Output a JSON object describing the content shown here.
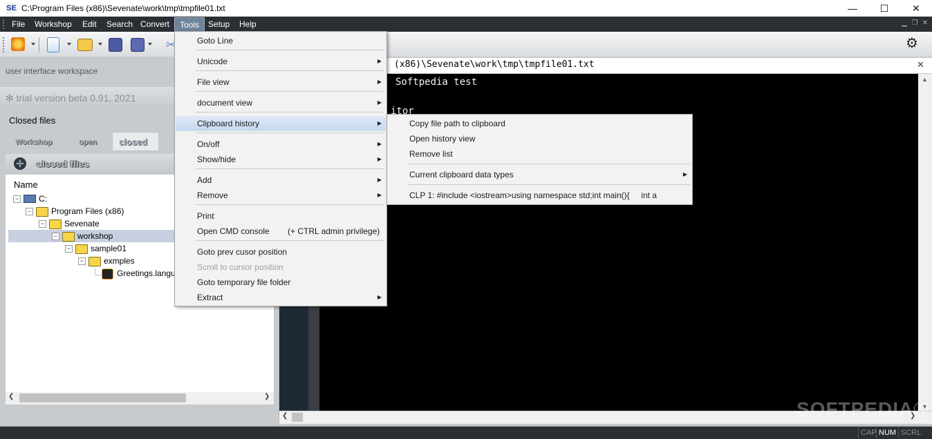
{
  "window": {
    "title": "C:\\Program Files (x86)\\Sevenate\\work\\tmp\\tmpfile01.txt",
    "logo_text": "SE",
    "minimize_glyph": "—",
    "maximize_glyph": "☐",
    "close_glyph": "✕"
  },
  "menubar": {
    "items": [
      "File",
      "Workshop",
      "Edit",
      "Search",
      "Convert",
      "Tools",
      "Setup",
      "Help"
    ],
    "active": "Tools"
  },
  "toolbar": {
    "icons": [
      "settings-tool-icon",
      "new-file-icon",
      "open-folder-icon",
      "save-icon",
      "save-all-icon",
      "cut-icon"
    ],
    "gear_glyph": "⚙"
  },
  "left_panel": {
    "workspace_label": "user interface workspace",
    "trial_text": "✻ trial version beta 0.91, 2021",
    "section_title": "Closed files",
    "tabs": [
      "Workshop",
      "open",
      "closed"
    ],
    "active_tab": "closed",
    "closed_header": "closed files",
    "tree_header": "Name",
    "tree": [
      {
        "label": "C:",
        "level": 0,
        "type": "drive"
      },
      {
        "label": "Program Files (x86)",
        "level": 1,
        "type": "folder"
      },
      {
        "label": "Sevenate",
        "level": 2,
        "type": "folder"
      },
      {
        "label": "workshop",
        "level": 3,
        "type": "folder",
        "selected": true
      },
      {
        "label": "sample01",
        "level": 4,
        "type": "folder"
      },
      {
        "label": "exmples",
        "level": 5,
        "type": "folder"
      },
      {
        "label": "Greetings.langu",
        "level": 6,
        "type": "file"
      }
    ]
  },
  "editor": {
    "tab_path": "(x86)\\Sevenate\\work\\tmp\\tmpfile01.txt",
    "close_glyph": "✕",
    "lines": [
      "Softpedia test",
      "itor"
    ]
  },
  "tools_menu": {
    "items": [
      {
        "label": "Goto Line",
        "submenu": false
      },
      {
        "sep": true
      },
      {
        "label": "Unicode",
        "submenu": true
      },
      {
        "sep": true
      },
      {
        "label": "File view",
        "submenu": true
      },
      {
        "sep": true
      },
      {
        "label": "document view",
        "submenu": true
      },
      {
        "sep": true
      },
      {
        "label": "Clipboard history",
        "submenu": true,
        "highlighted": true
      },
      {
        "sep": true
      },
      {
        "label": "On/off",
        "submenu": true
      },
      {
        "label": "Show/hide",
        "submenu": true
      },
      {
        "sep": true
      },
      {
        "label": "Add",
        "submenu": true
      },
      {
        "label": "Remove",
        "submenu": true
      },
      {
        "sep": true
      },
      {
        "label": "Print",
        "submenu": false
      },
      {
        "label": "Open CMD console",
        "accel": "(+ CTRL admin privilege)",
        "submenu": false
      },
      {
        "sep": true
      },
      {
        "label": "Goto prev cusor position",
        "submenu": false
      },
      {
        "label": "Scroll to cursor position",
        "submenu": false,
        "disabled": true
      },
      {
        "label": "Goto temporary file folder",
        "submenu": false
      },
      {
        "label": "Extract",
        "submenu": true
      }
    ]
  },
  "clipboard_submenu": {
    "items": [
      {
        "label": "Copy file path to clipboard",
        "submenu": false
      },
      {
        "label": "Open history view",
        "submenu": false
      },
      {
        "label": "Remove list",
        "submenu": false
      },
      {
        "sep": true
      },
      {
        "label": "Current clipboard data types",
        "submenu": true
      },
      {
        "sep": true
      },
      {
        "label": "CLP 1: #include <iostream>using namespace std;int main(){     int a",
        "submenu": false
      }
    ]
  },
  "statusbar": {
    "cells": [
      "CAP",
      "NUM",
      "SCRL"
    ],
    "active": [
      "NUM"
    ]
  },
  "watermark": "SOFTPEDIA®",
  "colors": {
    "menubar_bg": "#2b2f34",
    "menu_highlight": "#c6d9f1",
    "editor_bg": "#000000",
    "panel_bg": "#c8cbce"
  }
}
